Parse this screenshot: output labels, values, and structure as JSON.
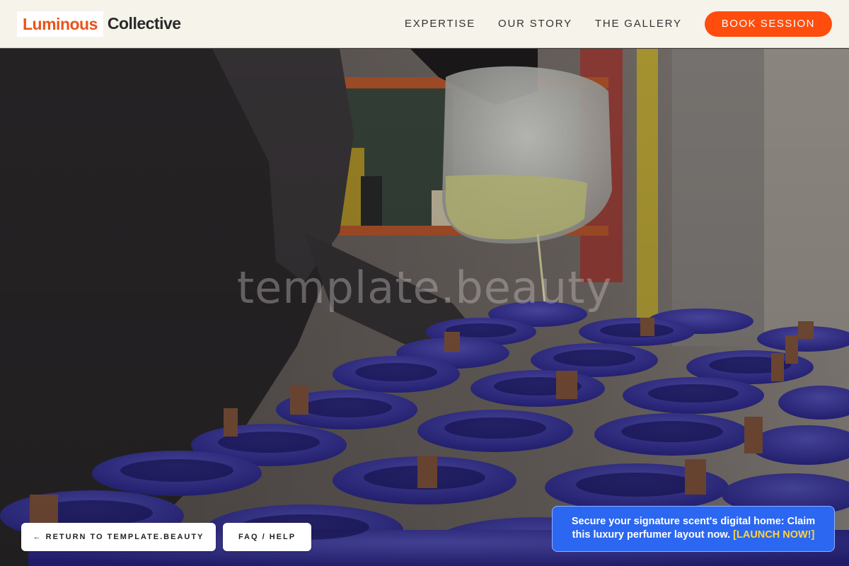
{
  "brand": {
    "name_part1": "Luminous",
    "name_part2": "Collective",
    "accent_color": "#ff4d0d"
  },
  "nav": {
    "items": [
      {
        "label": "EXPERTISE"
      },
      {
        "label": "OUR STORY"
      },
      {
        "label": "THE GALLERY"
      }
    ],
    "cta_label": "BOOK SESSION"
  },
  "hero": {
    "watermark": "template.beauty",
    "image_subject": "candle-pouring-photo"
  },
  "footer_buttons": {
    "return_label": "← RETURN TO TEMPLATE.BEAUTY",
    "faq_label": "FAQ / HELP"
  },
  "promo": {
    "text": "Secure your signature scent's digital home: Claim this luxury perfumer layout now.",
    "cta": "[LAUNCH NOW!]",
    "background_color": "#2b67f0",
    "cta_color": "#ffd43b"
  }
}
